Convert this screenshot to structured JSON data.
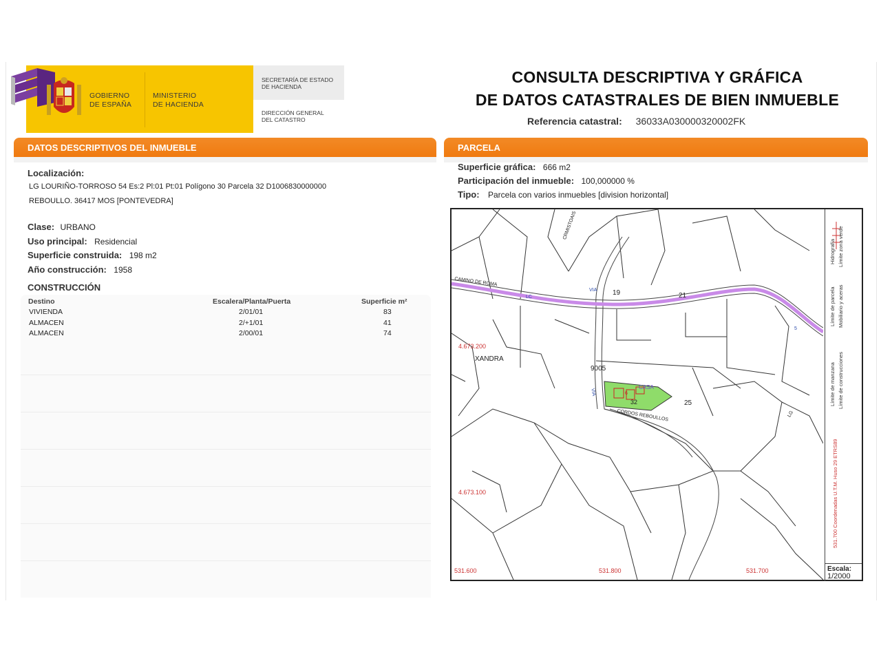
{
  "header": {
    "gobierno": "GOBIERNO DE ESPAÑA",
    "gobierno_l1": "GOBIERNO",
    "gobierno_l2": "DE ESPAÑA",
    "ministerio_l1": "MINISTERIO",
    "ministerio_l2": "DE HACIENDA",
    "secretaria_l1": "SECRETARÍA DE ESTADO",
    "secretaria_l2": "DE HACIENDA",
    "direccion_l1": "DIRECCIÓN GENERAL",
    "direccion_l2": "DEL CATASTRO",
    "title_l1": "CONSULTA DESCRIPTIVA Y GRÁFICA",
    "title_l2": "DE DATOS CATASTRALES DE BIEN INMUEBLE",
    "ref_label": "Referencia catastral:",
    "ref_value": "36033A030000320002FK"
  },
  "descriptivos": {
    "section_title": "DATOS DESCRIPTIVOS DEL INMUEBLE",
    "localizacion_label": "Localización:",
    "localizacion_l1": "LG LOURIÑO-TORROSO 54 Es:2 Pl:01 Pt:01 Polígono 30 Parcela 32 D1006830000000",
    "localizacion_l2": "REBOULLO. 36417 MOS [PONTEVEDRA]",
    "clase_label": "Clase:",
    "clase_value": "URBANO",
    "uso_label": "Uso principal:",
    "uso_value": "Residencial",
    "superficie_label": "Superficie construida:",
    "superficie_value": "198 m2",
    "anio_label": "Año construcción:",
    "anio_value": "1958",
    "construccion_title": "CONSTRUCCIÓN",
    "table": {
      "headers": [
        "Destino",
        "Escalera/Planta/Puerta",
        "Superficie m²"
      ],
      "rows": [
        [
          "VIVIENDA",
          "2/01/01",
          "83"
        ],
        [
          "ALMACEN",
          "2/+1/01",
          "41"
        ],
        [
          "ALMACEN",
          "2/00/01",
          "74"
        ]
      ]
    }
  },
  "parcela": {
    "section_title": "PARCELA",
    "sup_grafica_label": "Superficie gráfica:",
    "sup_grafica_value": "666 m2",
    "participacion_label": "Participación del inmueble:",
    "participacion_value": "100,000000 %",
    "tipo_label": "Tipo:",
    "tipo_value": "Parcela con varios inmuebles [division horizontal]"
  },
  "map": {
    "labels": {
      "p19": "19",
      "p21": "21",
      "p25": "25",
      "p9005": "9005",
      "p32": "32",
      "xandra": "XANDRA",
      "y1": "4.673.200",
      "y2": "4.673.100",
      "x1": "531.600",
      "x2": "531.800",
      "x3": "531.700",
      "camino": "CAMINO DE ROMA",
      "casa": "CASA",
      "via1": "VIA",
      "via2": "VIA",
      "lc": "LC",
      "lg": "LG",
      "road2": "CORDOS REBOULLOS",
      "road3": "CRMISTOAIS",
      "b5": "5",
      "b6": "6"
    },
    "legend": {
      "l1": "Límite de manzana",
      "l2": "Límite de parcela",
      "l3": "Hidrografía",
      "l4": "Límite de construcciones",
      "l5": "Mobiliario y aceras",
      "l6": "Límite zona verde",
      "coords": "531.700 Coordenadas U.T.M. Huso 29 ETRS89"
    },
    "scale_label": "Escala:",
    "scale_value": "1/2000"
  },
  "colors": {
    "orange": "#f07a10",
    "yellow": "#f7c500",
    "road": "#c98ae8",
    "building": "#8fdc6a"
  }
}
